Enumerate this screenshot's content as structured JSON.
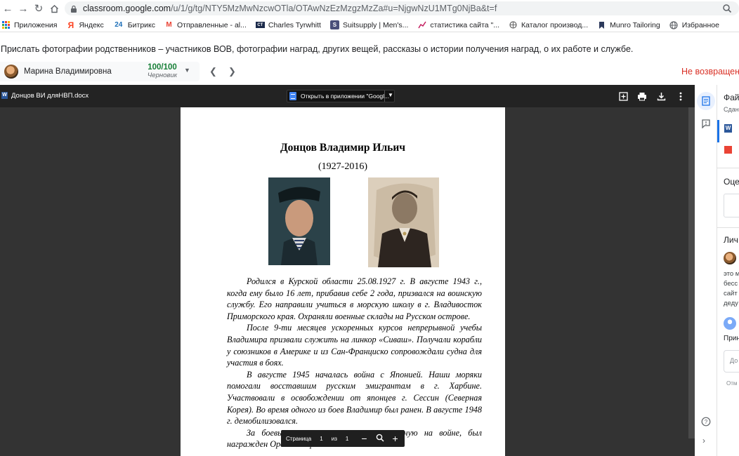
{
  "browser": {
    "url_host": "classroom.google.com",
    "url_path": "/u/1/g/tg/NTY5MzMwNzcwOTla/OTAwNzEzMzgzMzZa#u=NjgwNzU1MTg0NjBa&t=f"
  },
  "bookmarks": [
    {
      "label": "Приложения",
      "icon": "apps-grid-icon"
    },
    {
      "label": "Яндекс",
      "icon": "yandex-icon"
    },
    {
      "label": "Битрикс",
      "icon": "bitrix24-icon"
    },
    {
      "label": "Отправленные - al...",
      "icon": "gmail-icon"
    },
    {
      "label": "Charles Tyrwhitt",
      "icon": "ct-icon"
    },
    {
      "label": "Suitsupply | Men's...",
      "icon": "suitsupply-icon"
    },
    {
      "label": "статистика сайта \"...",
      "icon": "chart-line-icon"
    },
    {
      "label": "Каталог производ...",
      "icon": "catalog-icon"
    },
    {
      "label": "Munro Tailoring",
      "icon": "munro-icon"
    },
    {
      "label": "Избранное",
      "icon": "globe-icon"
    }
  ],
  "assignment": {
    "description": "Прислать фотографии родственников – участников ВОВ, фотографии наград, других вещей, рассказы о истории получения наград, о их работе и службе."
  },
  "student": {
    "name": "Марина Владимировна",
    "grade": "100/100",
    "status": "Черновик",
    "return_status": "Не возвращено"
  },
  "viewer": {
    "file_name": "Донцов ВИ дляНВП.docx",
    "open_in_app_label": "Открыть в приложении \"Googl...",
    "pager": {
      "label_page": "Страница",
      "current": "1",
      "label_of": "из",
      "total": "1"
    }
  },
  "document": {
    "title": "Донцов Владимир Ильич",
    "years": "(1927-2016)",
    "paragraphs": [
      "Родился в Курской области 25.08.1927 г. В августе 1943 г., когда ему было 16 лет, прибавив себе 2 года, призвался на воинскую службу. Его направили учиться в морскую школу в г. Владивосток Приморского края. Охраняли военные склады на Русском острове.",
      "После 9-ти месяцев ускоренных курсов непрерывной учебы Владимира призвали служить на линкор «Сиваш». Получали корабли у союзников в Америке и из Сан-Франциско сопровождали судна для участия в боях.",
      "В августе 1945 началась война с Японией. Наши моряки помогали восставшим русским эмигрантам в г. Харбине. Участвовали в освобождении от японцев г. Сессин (Северная Корея). Во время одного из боев Владимир был ранен. В августе 1948 г. демобилизовался.",
      "За боевые заслуги и отвагу, проявленную на войне, был награжден Орденом Красной Звезды."
    ]
  },
  "side_panel": {
    "files_heading": "Фай",
    "files_sub": "Сдан",
    "grade_heading": "Оце",
    "private_heading": "Лич",
    "comment_lines": [
      "это м",
      "бесс",
      "сайт",
      "деду"
    ],
    "reply_label": "Прин",
    "comment_input_placeholder": "До",
    "cancel_label": "Отм"
  }
}
